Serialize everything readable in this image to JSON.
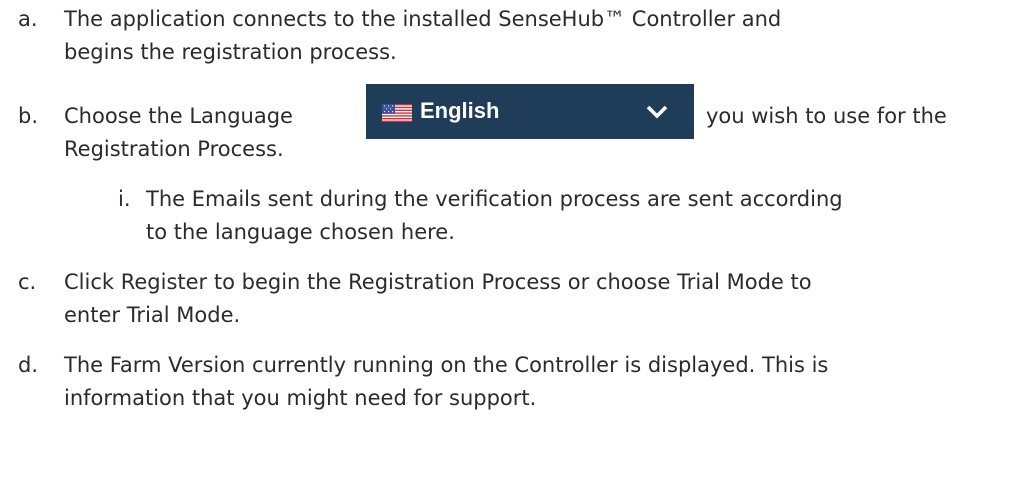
{
  "list": {
    "a": {
      "marker": "a.",
      "line1": "The application connects to the installed SenseHub™ Controller and",
      "line2": "begins the registration process."
    },
    "b": {
      "marker": "b.",
      "text_before": "Choose the Language",
      "text_after": "you wish to use for the",
      "line2": "Registration Process."
    },
    "b_i": {
      "marker": "i.",
      "line1": "The Emails sent during the verification process are sent according",
      "line2": "to the language chosen here."
    },
    "c": {
      "marker": "c.",
      "line1": "Click Register to begin the Registration Process or choose Trial Mode to",
      "line2": "enter Trial Mode."
    },
    "d": {
      "marker": "d.",
      "line1": "The Farm Version currently running on the Controller is displayed. This is",
      "line2": "information that you might need for support."
    }
  },
  "language_selector": {
    "label": "English",
    "flag_icon": "us-flag-icon",
    "dropdown_icon": "chevron-down-icon",
    "background_color": "#1f3d58",
    "text_color": "#ffffff"
  }
}
